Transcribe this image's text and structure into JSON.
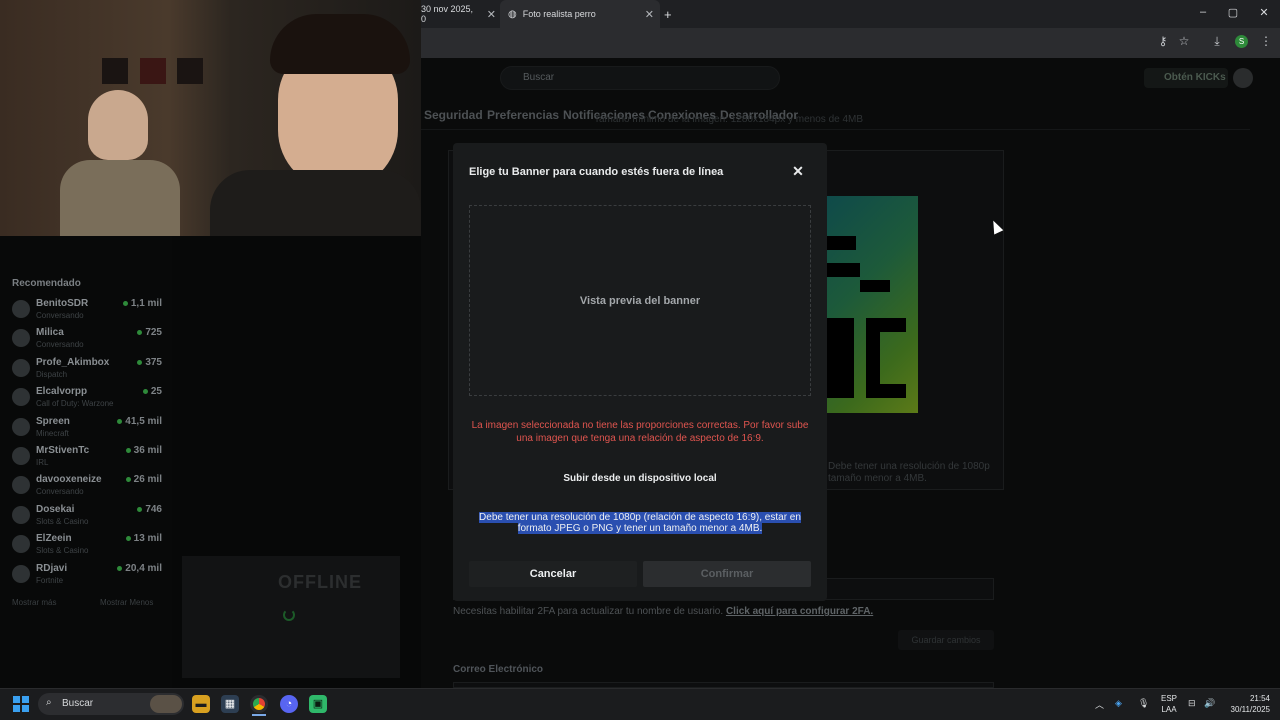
{
  "browser": {
    "tabs": [
      {
        "label": "30 nov 2025, 0"
      },
      {
        "label": "Foto realista perro"
      }
    ],
    "new_tab_symbol": "+"
  },
  "site": {
    "search_placeholder": "Buscar",
    "kicks_button": "Obtén KICKs",
    "settings_tabs": [
      "Seguridad",
      "Preferencias",
      "Notificaciones",
      "Conexiones",
      "Desarrollador"
    ],
    "behind_subtitle": "Tamaño mínimo de la imagen: 1280x184px y menos de 4MB",
    "behind_requirement": [
      "Debe tener una resolución de 1080p",
      "tamaño menor a 4MB."
    ],
    "twofa_text": "Necesitas habilitar 2FA para actualizar tu nombre de usuario.",
    "twofa_link": "Click aquí para configurar 2FA.",
    "email_label": "Correo Electrónico",
    "save_button": "Guardar cambios",
    "offline_label": "OFFLINE"
  },
  "sidebar": {
    "header": "Recomendado",
    "items": [
      {
        "name": "BenitoSDR",
        "category": "Conversando",
        "viewers": "1,1 mil"
      },
      {
        "name": "Milica",
        "category": "Conversando",
        "viewers": "725"
      },
      {
        "name": "Profe_Akimbox",
        "category": "Dispatch",
        "viewers": "375"
      },
      {
        "name": "Elcalvorpp",
        "category": "Call of Duty: Warzone",
        "viewers": "25"
      },
      {
        "name": "Spreen",
        "category": "Minecraft",
        "viewers": "41,5 mil"
      },
      {
        "name": "MrStivenTc",
        "category": "IRL",
        "viewers": "36 mil"
      },
      {
        "name": "davooxeneize",
        "category": "Conversando",
        "viewers": "26 mil"
      },
      {
        "name": "Dosekai",
        "category": "Slots & Casino",
        "viewers": "746"
      },
      {
        "name": "ElZeein",
        "category": "Slots & Casino",
        "viewers": "13 mil"
      },
      {
        "name": "RDjavi",
        "category": "Fortnite",
        "viewers": "20,4 mil"
      }
    ],
    "show_more": "Mostrar más",
    "show_less": "Mostrar Menos"
  },
  "modal": {
    "title": "Elige tu Banner para cuando estés fuera de línea",
    "close_symbol": "✕",
    "preview_label": "Vista previa del banner",
    "error_text": "La imagen seleccionada no tiene las proporciones correctas. Por favor sube una imagen que tenga una relación de aspecto de 16:9.",
    "upload_button": "Subir desde un dispositivo local",
    "requirement_text": "Debe tener una resolución de 1080p (relación de aspecto 16:9), estar en formato JPEG o PNG y tener un tamaño menor a 4MB.",
    "cancel_button": "Cancelar",
    "confirm_button": "Confirmar"
  },
  "taskbar": {
    "search_label": "Buscar",
    "language": [
      "ESP",
      "LAA"
    ],
    "time": "21:54",
    "date": "30/11/2025"
  },
  "colors": {
    "error": "#e0554f",
    "selection": "#2a4fb0",
    "kick_green": "#2e8a3a"
  }
}
